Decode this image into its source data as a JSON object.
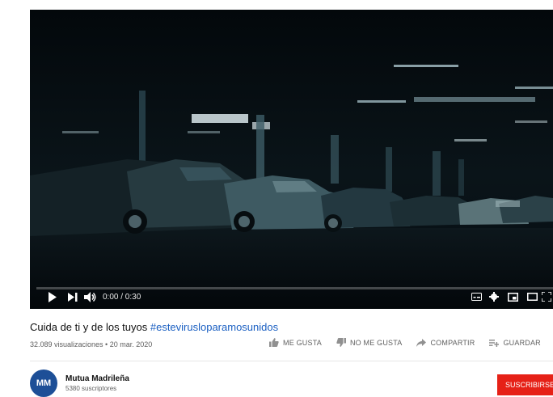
{
  "player": {
    "time_display": "0:00 / 0:30",
    "progress_fraction": 0.0
  },
  "video": {
    "title_text": "Cuida de ti y de los tuyos ",
    "hashtag": "#estevirusloparamosunidos",
    "views_date": "32.089 visualizaciones • 20 mar. 2020"
  },
  "actions": {
    "like": "ME GUSTA",
    "dislike": "NO ME GUSTA",
    "share": "COMPARTIR",
    "save": "GUARDAR",
    "more": "..."
  },
  "channel": {
    "avatar_text": "MM",
    "name": "Mutua Madrileña",
    "subscribers": "5380 suscriptores",
    "subscribe_label": "SUSCRIBIRSE"
  },
  "colors": {
    "accent": "#e62117",
    "hashtag": "#1a5fc2",
    "progress": "#ff0000",
    "avatar": "#1d4f97"
  }
}
